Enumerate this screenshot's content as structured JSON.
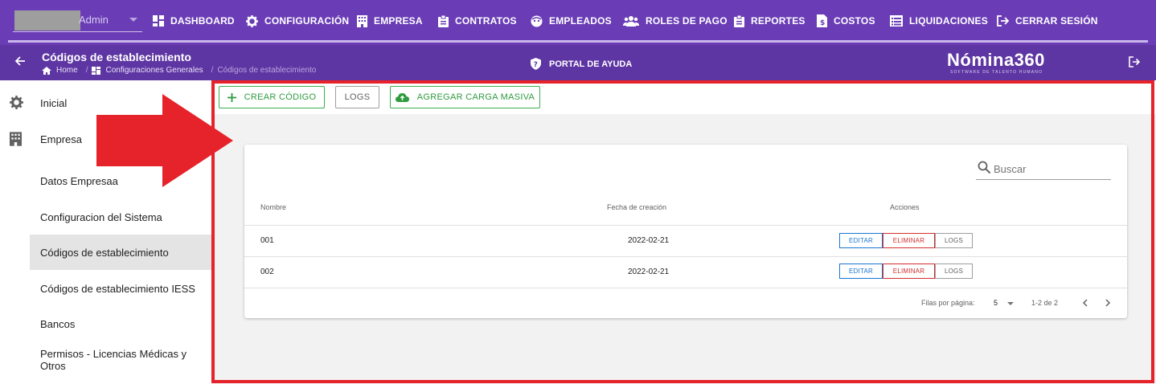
{
  "topbar": {
    "user_name": "Admin",
    "nav": [
      {
        "label": "DASHBOARD",
        "icon": "dashboard-icon"
      },
      {
        "label": "CONFIGURACIÓN",
        "icon": "gear-icon"
      },
      {
        "label": "EMPRESA",
        "icon": "building-icon"
      },
      {
        "label": "CONTRATOS",
        "icon": "clipboard-icon"
      },
      {
        "label": "EMPLEADOS",
        "icon": "face-icon"
      },
      {
        "label": "ROLES DE PAGO",
        "icon": "people-icon"
      },
      {
        "label": "REPORTES",
        "icon": "clipboard-icon"
      },
      {
        "label": "COSTOS",
        "icon": "invoice-icon"
      },
      {
        "label": "LIQUIDACIONES",
        "icon": "list-icon"
      },
      {
        "label": "CERRAR SESIÓN",
        "icon": "logout-icon"
      }
    ]
  },
  "subbar": {
    "title": "Códigos de establecimiento",
    "breadcrumb": [
      "Home",
      "Configuraciones Generales",
      "Códigos de establecimiento"
    ],
    "help": "PORTAL DE AYUDA",
    "logo": "Nómina360",
    "logo_tagline": "SOFTWARE DE TALENTO HUMANO"
  },
  "sidebar": {
    "items": [
      {
        "label": "Inicial",
        "icon": "gear-icon"
      },
      {
        "label": "Empresa",
        "icon": "building-icon"
      },
      {
        "label": "Datos Empresaa"
      },
      {
        "label": "Configuracion del Sistema"
      },
      {
        "label": "Códigos de establecimiento",
        "active": true
      },
      {
        "label": "Códigos de establecimiento IESS"
      },
      {
        "label": "Bancos"
      },
      {
        "label": "Permisos - Licencias Médicas y Otros"
      }
    ]
  },
  "toolbar": {
    "create_label": "CREAR CÓDIGO",
    "logs_label": "LOGS",
    "bulk_label": "AGREGAR CARGA MASIVA"
  },
  "table": {
    "search_placeholder": "Buscar",
    "headers": [
      "Nombre",
      "Fecha de creación",
      "Acciones"
    ],
    "rows": [
      {
        "name": "001",
        "date": "2022-02-21"
      },
      {
        "name": "002",
        "date": "2022-02-21"
      }
    ],
    "action_labels": {
      "edit": "EDITAR",
      "delete": "ELIMINAR",
      "logs": "LOGS"
    },
    "rows_per_page_label": "Filas por página:",
    "rows_per_page": "5",
    "range": "1-2 de 2"
  },
  "colors": {
    "primary": "#6a3db6",
    "green": "#3cae4c",
    "highlight": "#e6222a"
  }
}
